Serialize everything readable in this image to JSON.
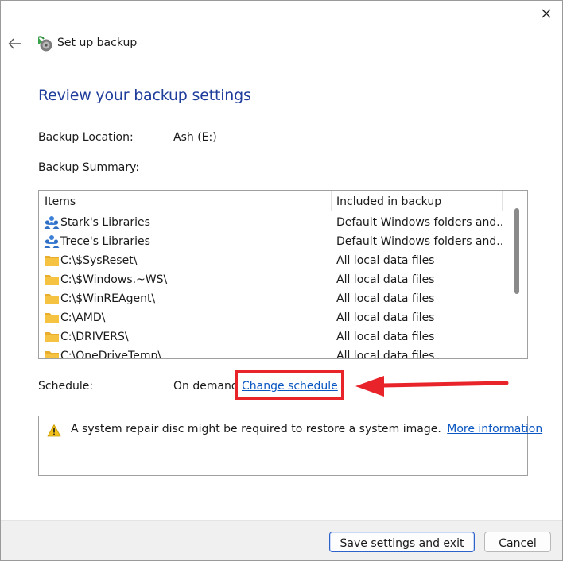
{
  "window": {
    "title": "Set up backup"
  },
  "page": {
    "heading": "Review your backup settings",
    "location_label": "Backup Location:",
    "location_value": "Ash (E:)",
    "summary_label": "Backup Summary:"
  },
  "summary_table": {
    "columns": [
      "Items",
      "Included in backup"
    ],
    "rows": [
      {
        "icon": "libraries-icon",
        "name": "Stark's Libraries",
        "included": "Default Windows folders and..."
      },
      {
        "icon": "libraries-icon",
        "name": "Trece's Libraries",
        "included": "Default Windows folders and..."
      },
      {
        "icon": "folder-icon",
        "name": "C:\\$SysReset\\",
        "included": "All local data files"
      },
      {
        "icon": "folder-icon",
        "name": "C:\\$Windows.~WS\\",
        "included": "All local data files"
      },
      {
        "icon": "folder-icon",
        "name": "C:\\$WinREAgent\\",
        "included": "All local data files"
      },
      {
        "icon": "folder-icon",
        "name": "C:\\AMD\\",
        "included": "All local data files"
      },
      {
        "icon": "folder-icon",
        "name": "C:\\DRIVERS\\",
        "included": "All local data files"
      },
      {
        "icon": "folder-icon",
        "name": "C:\\OneDriveTemp\\",
        "included": "All local data files"
      }
    ]
  },
  "schedule": {
    "label": "Schedule:",
    "value": "On demand",
    "change_link": "Change schedule"
  },
  "warning": {
    "text": "A system repair disc might be required to restore a system image.",
    "link": "More information"
  },
  "footer": {
    "save_label": "Save settings and exit",
    "cancel_label": "Cancel"
  },
  "colors": {
    "heading": "#1e3c9a",
    "link": "#0a57c2",
    "highlight": "#e8242a",
    "folder": "#f5c242"
  }
}
